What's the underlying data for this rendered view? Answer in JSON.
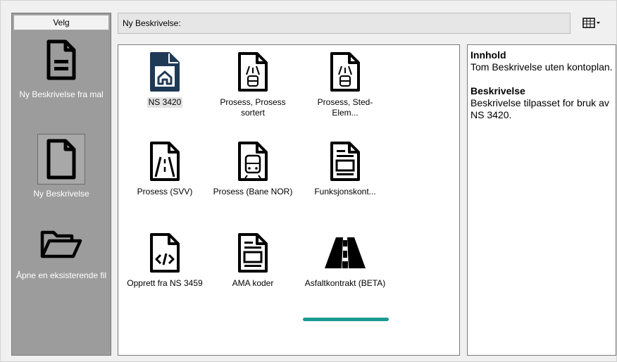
{
  "sidebar": {
    "select_label": "Velg",
    "items": [
      {
        "label": "Ny Beskrivelse fra mal",
        "icon": "document-lines-icon"
      },
      {
        "label": "Ny Beskrivelse",
        "icon": "blank-document-icon"
      },
      {
        "label": "Åpne en eksisterende fil",
        "icon": "open-folder-icon"
      }
    ]
  },
  "header": {
    "title": "Ny Beskrivelse:",
    "view_button_icon": "view-options-icon"
  },
  "templates": [
    {
      "label": "NS 3420",
      "icon": "home-document-icon",
      "selected": true
    },
    {
      "label": "Prosess, Prosess sortert",
      "icon": "train-road-document-icon"
    },
    {
      "label": "Prosess, Sted-Elem...",
      "icon": "train-road-document-icon"
    },
    {
      "label": "Prosess (SVV)",
      "icon": "road-document-icon"
    },
    {
      "label": "Prosess (Bane NOR)",
      "icon": "train-document-icon"
    },
    {
      "label": "Funksjonskont...",
      "icon": "form-document-icon"
    },
    {
      "label": "Opprett fra NS 3459",
      "icon": "code-document-icon"
    },
    {
      "label": "AMA koder",
      "icon": "form-document-icon"
    },
    {
      "label": "Asfaltkontrakt (BETA)",
      "icon": "road-icon"
    }
  ],
  "description": {
    "content_heading": "Innhold",
    "content_text": "Tom Beskrivelse uten kontoplan.",
    "description_heading": "Beskrivelse",
    "description_text": "Beskrivelse tilpasset for bruk av NS 3420."
  },
  "colors": {
    "sidebar_bg": "#9c9c9c",
    "selected_icon": "#1f3a57",
    "accent_bar": "#1a9a92"
  }
}
